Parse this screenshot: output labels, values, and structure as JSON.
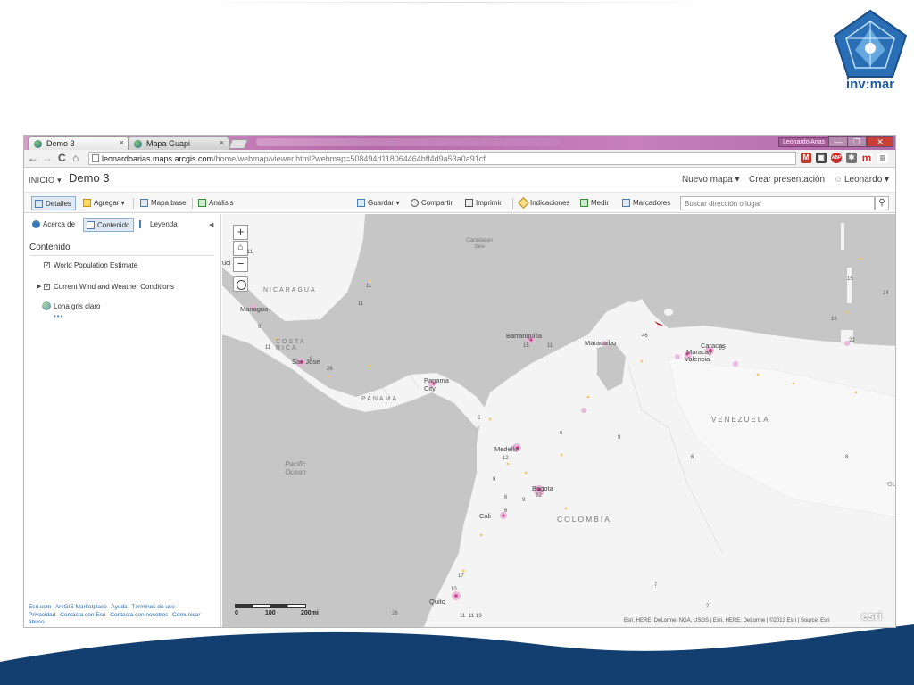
{
  "slide": {
    "logo_text": "inv:mar"
  },
  "browser": {
    "tabs": [
      {
        "label": "Demo 3",
        "close": "×"
      },
      {
        "label": "Mapa Guapi",
        "close": "×"
      }
    ],
    "user_chip": "Leonardo Arias",
    "window_buttons": {
      "min": "—",
      "max": "❐",
      "close": "✕"
    },
    "nav": {
      "back": "←",
      "forward": "→",
      "reload": "C",
      "home": "⌂",
      "star": "☆"
    },
    "url_host": "leonardoarias.maps.arcgis.com",
    "url_path": "/home/webmap/viewer.html?webmap=508494d118064464bff4d9a53a0a91cf",
    "extensions": [
      "M",
      "▣",
      "ABP",
      "✱",
      "m",
      "≡"
    ]
  },
  "header": {
    "inicio": "INICIO ▾",
    "title": "Demo 3",
    "nuevo_mapa": "Nuevo mapa ▾",
    "crear_presentacion": "Crear presentación",
    "user": "Leonardo ▾"
  },
  "toolbar": {
    "detalles": "Detalles",
    "agregar": "Agregar ▾",
    "mapa_base": "Mapa base",
    "analisis": "Análisis",
    "guardar": "Guardar ▾",
    "compartir": "Compartir",
    "imprimir": "Imprimir",
    "indicaciones": "Indicaciones",
    "medir": "Medir",
    "marcadores": "Marcadores",
    "search_placeholder": "Buscar dirección o lugar"
  },
  "panel": {
    "tabs": {
      "acerca": "Acerca de",
      "contenido": "Contenido",
      "leyenda": "Leyenda"
    },
    "heading": "Contenido",
    "layers": [
      "World Population Estimate",
      "Current Wind and Weather Conditions"
    ],
    "basemap": "Lona gris claro",
    "dots": "•••",
    "footer_links": [
      "Esri.com",
      "ArcGIS Marketplace",
      "Ayuda",
      "Términos de uso",
      "Privacidad",
      "Contacta con Esri",
      "Contacta con nosotros",
      "Comunicar abuso"
    ]
  },
  "map": {
    "zoom_in": "+",
    "zoom_out": "−",
    "labels": {
      "caribbean": "Caribbean Sea",
      "pacific": "Pacific Ocean",
      "nicaragua": "NICARAGUA",
      "costa_rica": "COSTA RICA",
      "panama_country": "PANAMA",
      "venezuela": "VENEZUELA",
      "colombia": "COLOMBIA",
      "managua": "Managua",
      "san_jose": "San Jose",
      "panama_city": "Panama City",
      "barranquilla": "Barranquilla",
      "maracaibo": "Maracaibo",
      "caracas": "Caracas",
      "maracay": "Maracay",
      "valencia": "Valencia",
      "medellin": "Medellin",
      "bogota": "Bogota",
      "cali": "Cali",
      "quito": "Quito",
      "tegucigalpa_cut": "uci",
      "gu_cut": "GU"
    },
    "wind_numbers": [
      "11",
      "9",
      "11",
      "8",
      "26",
      "11",
      "11",
      "6",
      "15",
      "11",
      "46",
      "15",
      "6",
      "9",
      "6",
      "6",
      "9",
      "22",
      "6",
      "12",
      "9",
      "11",
      "11",
      "13",
      "22",
      "18",
      "15",
      "24",
      "8",
      "7",
      "2",
      "26",
      "10",
      "17"
    ],
    "scale": {
      "zero": "0",
      "mid": "100",
      "end": "200mi"
    },
    "attribution": "Esri, HERE, DeLorme, NGA, USGS | Esri, HERE, DeLorme | ©2013 Esri | Source: Esri",
    "esri": "esri"
  }
}
